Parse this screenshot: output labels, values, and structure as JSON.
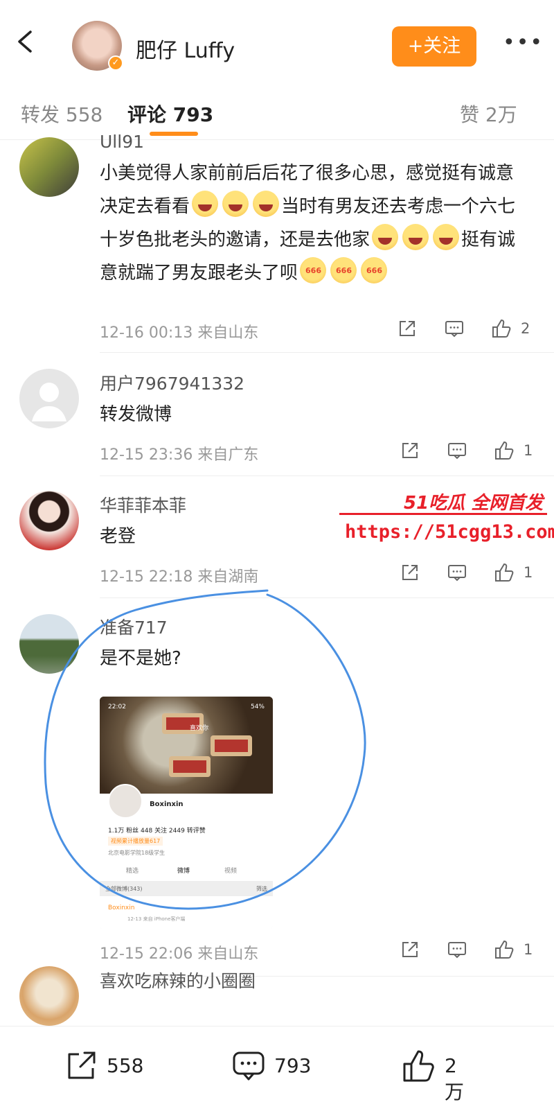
{
  "header": {
    "title": "肥仔 Luffy",
    "follow_label": "+关注",
    "more_label": "•••"
  },
  "tabs": [
    {
      "label": "转发 558"
    },
    {
      "label": "评论 793"
    },
    {
      "label": "赞 2万"
    }
  ],
  "comments": [
    {
      "name": "Ull91",
      "text_part1": "小美觉得人家前前后后花了很多心思，感觉挺有诚意决定去看看",
      "text_part2": "当时有男友还去考虑一个六七十岁色批老头的邀请，还是去他家",
      "text_part3": "挺有诚意就踹了男友跟老头了呗",
      "meta": "12-16 00:13 来自山东",
      "likes": "2"
    },
    {
      "name": "用户7967941332",
      "text": "转发微博",
      "meta": "12-15 23:36 来自广东",
      "likes": "1"
    },
    {
      "name": "华菲菲本菲",
      "text": "老登",
      "meta": "12-15 22:18 来自湖南",
      "likes": "1"
    },
    {
      "name": "准备717",
      "text": "是不是她?",
      "meta": "12-15 22:06 来自山东",
      "likes": "1"
    },
    {
      "name": "喜欢吃麻辣的小圈圈"
    }
  ],
  "embedded_shot": {
    "time": "22:02",
    "battery": "54%",
    "like_label": "喜欢你",
    "name": "Boxinxin",
    "stats": "1.1万 粉丝    448 关注    2449 转评赞",
    "tag": "视频累计播放量617",
    "school": "北京电影学院18级学生",
    "tabs": [
      "精选",
      "微博",
      "视频"
    ],
    "bar_left": "全部微博(343)",
    "bar_right": "筛选",
    "post_name": "Boxinxin",
    "post_meta": "12-13 来自 iPhone客户端"
  },
  "watermark": {
    "line1": "51吃瓜 全网首发",
    "line2": "https://51cgg13.com"
  },
  "bottom_bar": {
    "reposts": "558",
    "comments": "793",
    "likes": "2万"
  },
  "colors": {
    "accent": "#ff8d1a",
    "watermark": "#e8202a",
    "circle": "#4a90e2"
  }
}
